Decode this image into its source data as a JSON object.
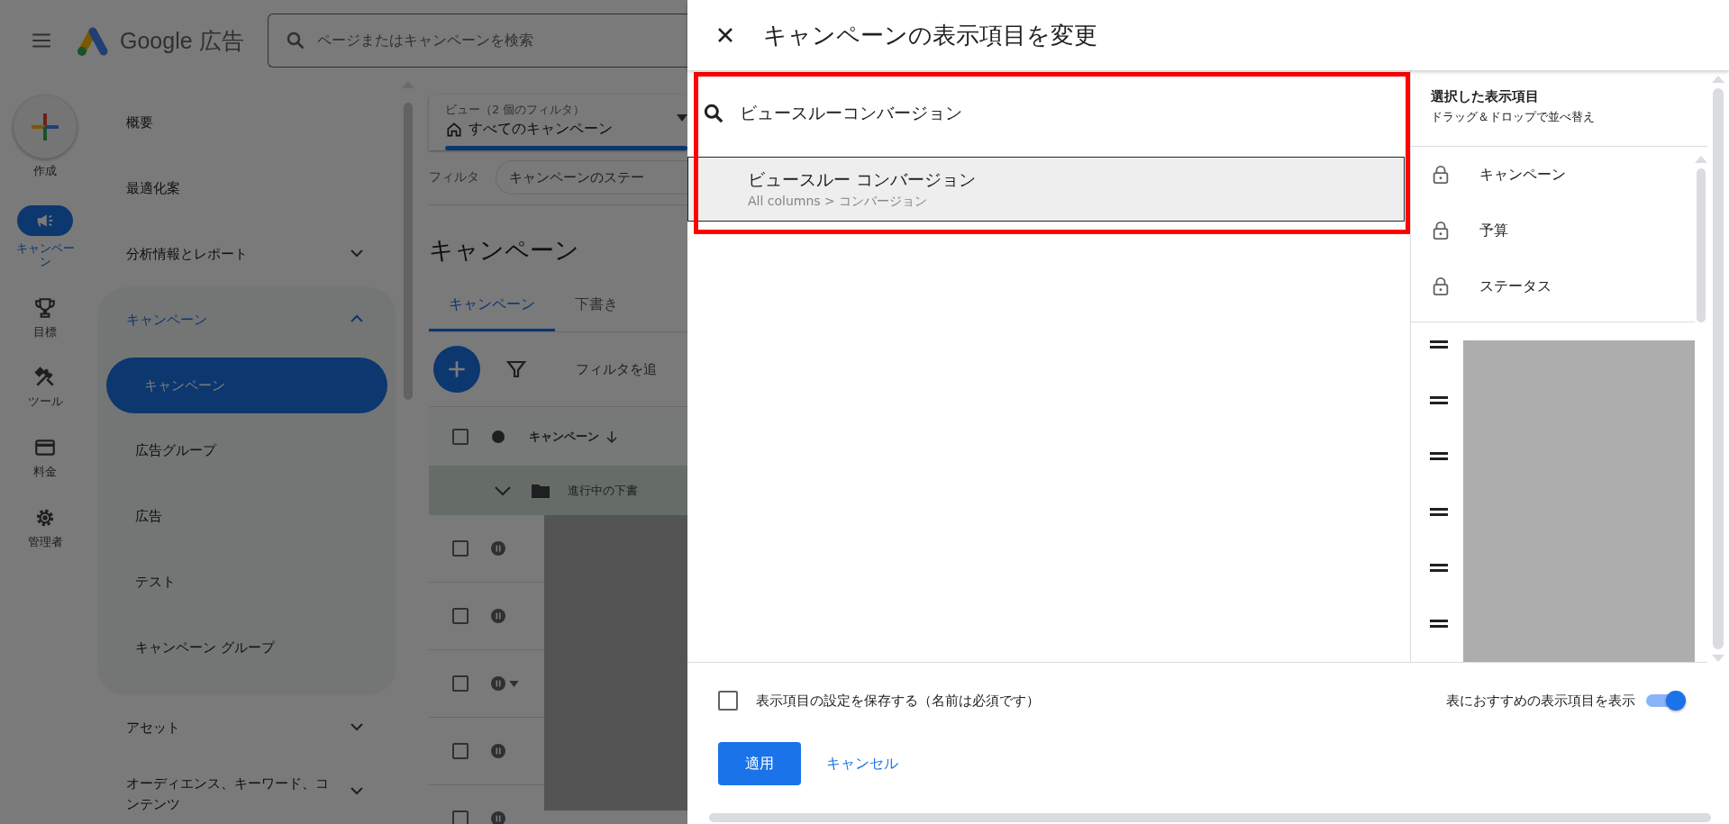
{
  "header": {
    "app_name": "Google 広告",
    "search_placeholder": "ページまたはキャンペーンを検索"
  },
  "rail": [
    {
      "label": "作成",
      "kind": "create",
      "selected": false
    },
    {
      "label": "キャンペーン",
      "kind": "campaigns",
      "selected": true
    },
    {
      "label": "目標",
      "kind": "goals",
      "selected": false
    },
    {
      "label": "ツール",
      "kind": "tools",
      "selected": false
    },
    {
      "label": "料金",
      "kind": "billing",
      "selected": false
    },
    {
      "label": "管理者",
      "kind": "admin",
      "selected": false
    }
  ],
  "nav": [
    {
      "label": "概要"
    },
    {
      "label": "最適化案"
    },
    {
      "label": "分析情報とレポート",
      "expanded": false
    },
    {
      "label": "キャンペーン",
      "expanded": true,
      "children": [
        {
          "label": "キャンペーン",
          "selected": true
        },
        {
          "label": "広告グループ",
          "selected": false
        },
        {
          "label": "広告",
          "selected": false
        },
        {
          "label": "テスト",
          "selected": false
        },
        {
          "label": "キャンペーン グループ",
          "selected": false
        }
      ]
    },
    {
      "label": "アセット",
      "expanded": false
    },
    {
      "label": "オーディエンス、キーワード、コンテンツ",
      "expanded": false
    }
  ],
  "main": {
    "view": {
      "label": "ビュー（2 個のフィルタ）",
      "value": "すべてのキャンペーン"
    },
    "filter_label": "フィルタ",
    "filter_chip": "キャンペーンのステー",
    "title": "キャンペーン",
    "tabs": [
      {
        "label": "キャンペーン",
        "selected": true
      },
      {
        "label": "下書き",
        "selected": false
      }
    ],
    "add_filter": "フィルタを追",
    "table": {
      "column": "キャンペーン",
      "header_checked": false,
      "group_row": "進行中の下書",
      "rows": [
        {
          "kind": "paused",
          "checked": false,
          "status_menu": false
        },
        {
          "kind": "paused",
          "checked": false,
          "status_menu": false
        },
        {
          "kind": "paused",
          "checked": false,
          "status_menu": true
        },
        {
          "kind": "paused",
          "checked": false,
          "status_menu": false
        },
        {
          "kind": "paused",
          "checked": false,
          "status_menu": false
        }
      ]
    }
  },
  "dialog": {
    "title": "キャンペーンの表示項目を変更",
    "search_value": "ビュースルーコンバージョン",
    "results": [
      {
        "name": "ビュースルー コンバージョン",
        "path": "All columns > コンバージョン",
        "selected": true
      }
    ],
    "selected_panel": {
      "title": "選択した表示項目",
      "subtitle": "ドラッグ＆ドロップで並べ替え",
      "locked": [
        "キャンペーン",
        "予算",
        "ステータス"
      ],
      "movable": [
        {
          "kind": "redacted"
        },
        {
          "kind": "redacted"
        },
        {
          "kind": "redacted"
        },
        {
          "kind": "redacted"
        },
        {
          "kind": "redacted"
        },
        {
          "kind": "redacted"
        }
      ]
    },
    "save_option": {
      "label": "表示項目の設定を保存する（名前は必須です）",
      "checked": false
    },
    "recommend_toggle": {
      "label": "表におすすめの表示項目を表示",
      "on": true
    },
    "buttons": [
      {
        "label": "適用",
        "kind": "primary"
      },
      {
        "label": "キャンセル",
        "kind": "text"
      }
    ]
  }
}
